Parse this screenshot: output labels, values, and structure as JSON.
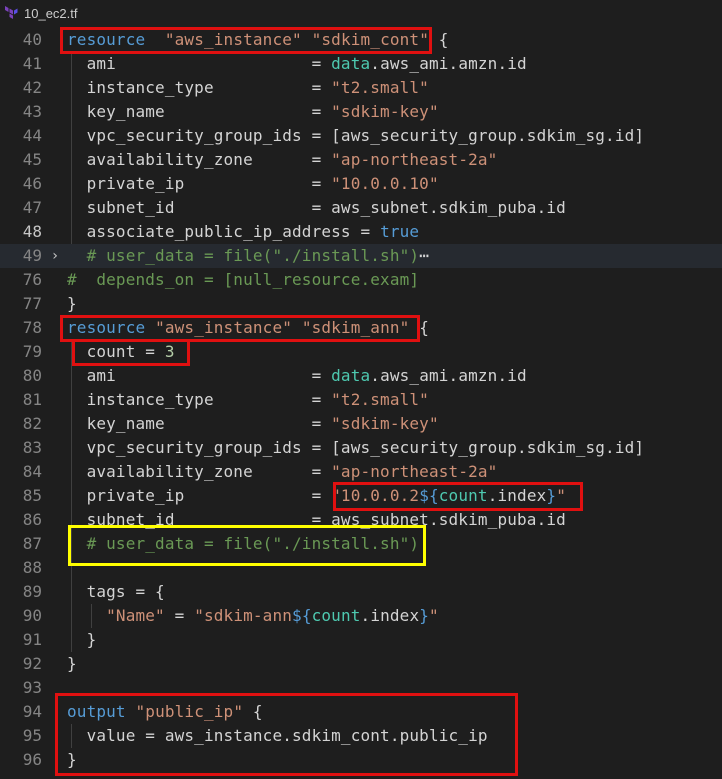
{
  "tab": {
    "filename": "10_ec2.tf",
    "icon": "terraform-icon"
  },
  "colors": {
    "highlight_red": "#e01010",
    "highlight_yellow": "#ffff00",
    "background": "#1e1e1e"
  },
  "lines": [
    {
      "n": "40",
      "tokens": [
        [
          "kw",
          "resource"
        ],
        [
          "",
          "  "
        ],
        [
          "str",
          "\"aws_instance\""
        ],
        [
          "",
          " "
        ],
        [
          "str",
          "\"sdkim_cont\""
        ],
        [
          "",
          " {"
        ]
      ]
    },
    {
      "n": "41",
      "tokens": [
        [
          "",
          "  ami                    = "
        ],
        [
          "acc",
          "data"
        ],
        [
          "",
          ".aws_ami.amzn.id"
        ]
      ]
    },
    {
      "n": "42",
      "tokens": [
        [
          "",
          "  instance_type          = "
        ],
        [
          "str",
          "\"t2.small\""
        ]
      ]
    },
    {
      "n": "43",
      "tokens": [
        [
          "",
          "  key_name               = "
        ],
        [
          "str",
          "\"sdkim-key\""
        ]
      ]
    },
    {
      "n": "44",
      "tokens": [
        [
          "",
          "  vpc_security_group_ids = [aws_security_group.sdkim_sg.id]"
        ]
      ]
    },
    {
      "n": "45",
      "tokens": [
        [
          "",
          "  availability_zone      = "
        ],
        [
          "str",
          "\"ap-northeast-2a\""
        ]
      ]
    },
    {
      "n": "46",
      "tokens": [
        [
          "",
          "  private_ip             = "
        ],
        [
          "str",
          "\"10.0.0.10\""
        ]
      ]
    },
    {
      "n": "47",
      "tokens": [
        [
          "",
          "  subnet_id              = aws_subnet.sdkim_puba.id"
        ]
      ]
    },
    {
      "n": "48",
      "tokens": [
        [
          "",
          "  associate_public_ip_address = "
        ],
        [
          "tru",
          "true"
        ]
      ]
    },
    {
      "n": "49",
      "tokens": [
        [
          "com",
          "  # user_data = file(\"./install.sh\")"
        ],
        [
          "",
          "⋯"
        ]
      ]
    },
    {
      "n": "76",
      "tokens": [
        [
          "com",
          "#  depends_on = [null_resource.exam]"
        ]
      ]
    },
    {
      "n": "77",
      "tokens": [
        [
          "",
          "}"
        ]
      ]
    },
    {
      "n": "78",
      "tokens": [
        [
          "kw",
          "resource"
        ],
        [
          "",
          " "
        ],
        [
          "str",
          "\"aws_instance\""
        ],
        [
          "",
          " "
        ],
        [
          "str",
          "\"sdkim_ann\""
        ],
        [
          "",
          " {"
        ]
      ]
    },
    {
      "n": "79",
      "tokens": [
        [
          "",
          "  count = "
        ],
        [
          "num",
          "3"
        ]
      ]
    },
    {
      "n": "80",
      "tokens": [
        [
          "",
          "  ami                    = "
        ],
        [
          "acc",
          "data"
        ],
        [
          "",
          ".aws_ami.amzn.id"
        ]
      ]
    },
    {
      "n": "81",
      "tokens": [
        [
          "",
          "  instance_type          = "
        ],
        [
          "str",
          "\"t2.small\""
        ]
      ]
    },
    {
      "n": "82",
      "tokens": [
        [
          "",
          "  key_name               = "
        ],
        [
          "str",
          "\"sdkim-key\""
        ]
      ]
    },
    {
      "n": "83",
      "tokens": [
        [
          "",
          "  vpc_security_group_ids = [aws_security_group.sdkim_sg.id]"
        ]
      ]
    },
    {
      "n": "84",
      "tokens": [
        [
          "",
          "  availability_zone      = "
        ],
        [
          "str",
          "\"ap-northeast-2a\""
        ]
      ]
    },
    {
      "n": "85",
      "tokens": [
        [
          "",
          "  private_ip             = "
        ],
        [
          "str",
          "\"10.0.0.2"
        ],
        [
          "kw",
          "${"
        ],
        [
          "acc",
          "count"
        ],
        [
          "",
          ".index"
        ],
        [
          "kw",
          "}"
        ],
        [
          "str",
          "\""
        ]
      ]
    },
    {
      "n": "86",
      "tokens": [
        [
          "",
          "  subnet_id              = aws_subnet.sdkim_puba.id"
        ]
      ]
    },
    {
      "n": "87",
      "tokens": [
        [
          "com",
          "  # user_data = file(\"./install.sh\")"
        ]
      ]
    },
    {
      "n": "88",
      "tokens": [
        [
          "",
          ""
        ]
      ]
    },
    {
      "n": "89",
      "tokens": [
        [
          "",
          "  tags = {"
        ]
      ]
    },
    {
      "n": "90",
      "tokens": [
        [
          "",
          "    "
        ],
        [
          "str",
          "\"Name\""
        ],
        [
          "",
          " = "
        ],
        [
          "str",
          "\"sdkim-ann"
        ],
        [
          "kw",
          "${"
        ],
        [
          "acc",
          "count"
        ],
        [
          "",
          ".index"
        ],
        [
          "kw",
          "}"
        ],
        [
          "str",
          "\""
        ]
      ]
    },
    {
      "n": "91",
      "tokens": [
        [
          "",
          "  }"
        ]
      ]
    },
    {
      "n": "92",
      "tokens": [
        [
          "",
          "}"
        ]
      ]
    },
    {
      "n": "93",
      "tokens": [
        [
          "",
          ""
        ]
      ]
    },
    {
      "n": "94",
      "tokens": [
        [
          "kw",
          "output"
        ],
        [
          "",
          " "
        ],
        [
          "str",
          "\"public_ip\""
        ],
        [
          "",
          " {"
        ]
      ]
    },
    {
      "n": "95",
      "tokens": [
        [
          "",
          "  value = aws_instance.sdkim_cont.public_ip"
        ]
      ]
    },
    {
      "n": "96",
      "tokens": [
        [
          "",
          "}"
        ]
      ]
    }
  ]
}
